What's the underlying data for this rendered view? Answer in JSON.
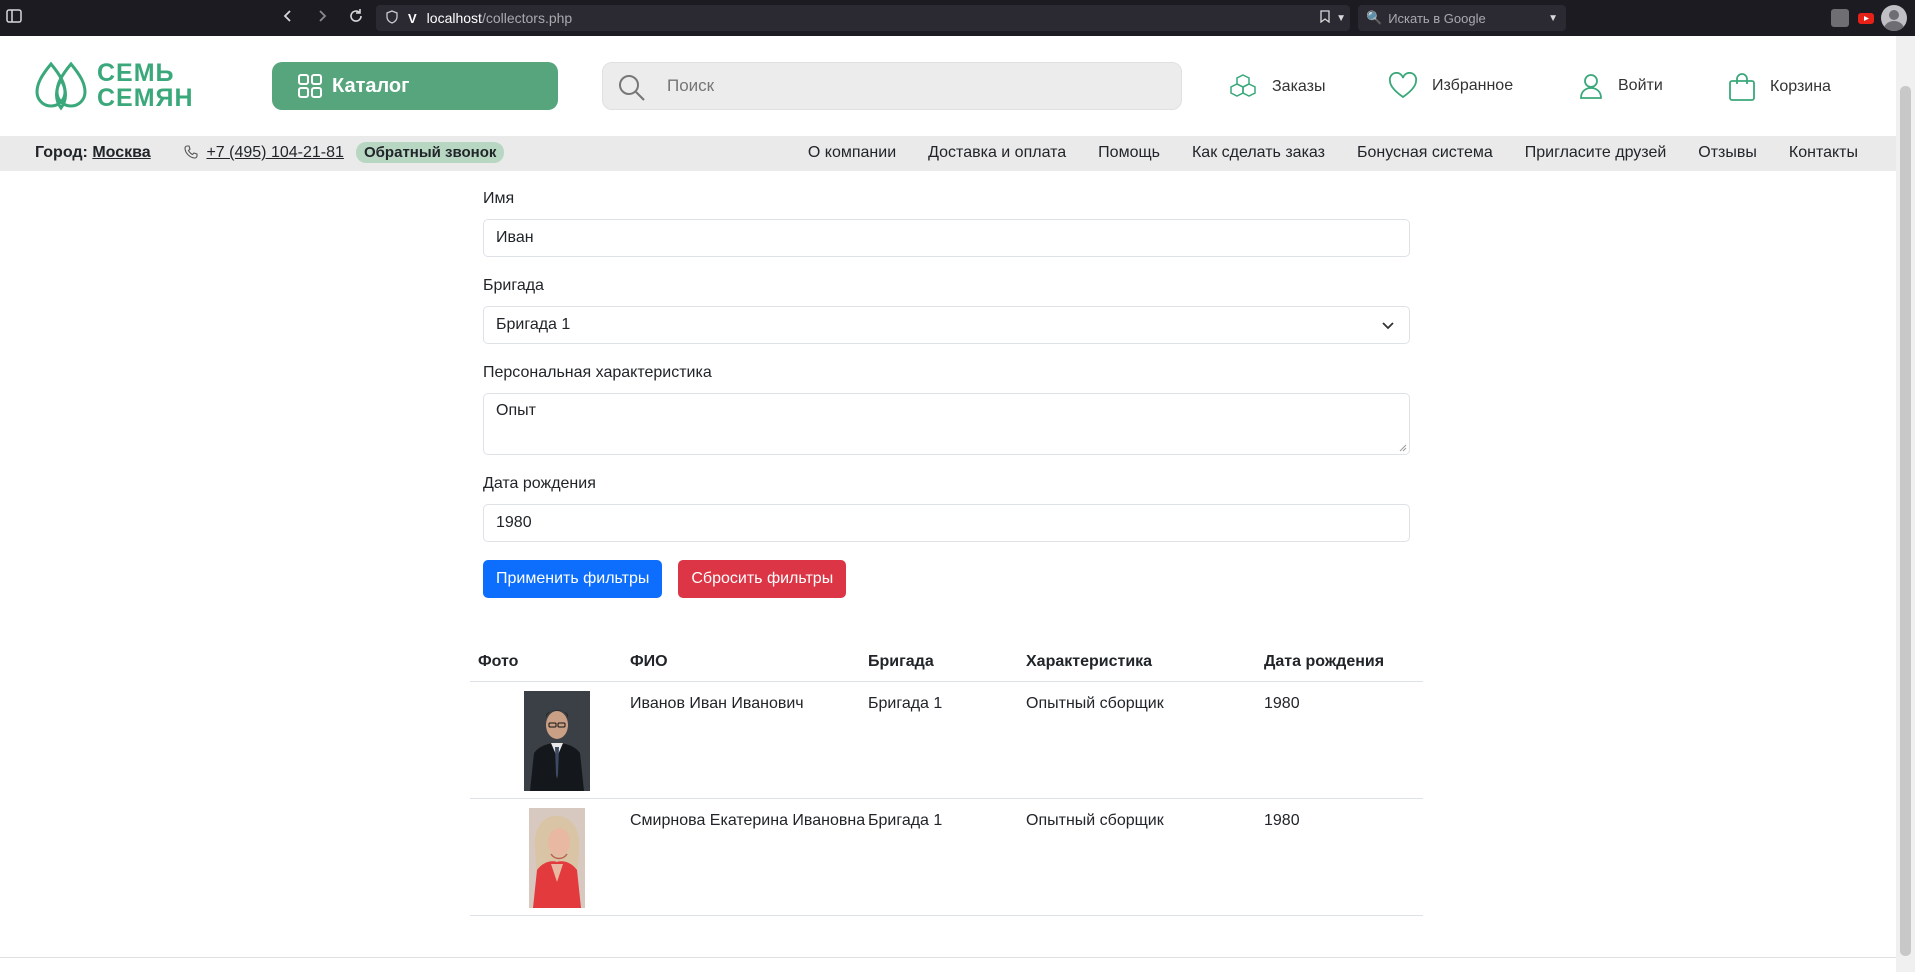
{
  "browser": {
    "url_host": "localhost",
    "url_path": "/collectors.php",
    "search_placeholder": "Искать в Google"
  },
  "header": {
    "logo_line1": "СЕМЬ",
    "logo_line2": "СЕМЯН",
    "catalog_label": "Каталог",
    "search_placeholder": "Поиск",
    "orders_label": "Заказы",
    "favorites_label": "Избранное",
    "login_label": "Войти",
    "cart_label": "Корзина"
  },
  "subnav": {
    "city_label": "Город:",
    "city_value": "Москва",
    "phone": "+7 (495) 104-21-81",
    "callback": "Обратный звонок",
    "menu": [
      "О компании",
      "Доставка и оплата",
      "Помощь",
      "Как сделать заказ",
      "Бонусная система",
      "Пригласите друзей",
      "Отзывы",
      "Контакты"
    ]
  },
  "form": {
    "name_label": "Имя",
    "name_value": "Иван",
    "brigade_label": "Бригада",
    "brigade_value": "Бригада 1",
    "characteristic_label": "Персональная характеристика",
    "characteristic_value": "Опыт",
    "birth_label": "Дата рождения",
    "birth_value": "1980",
    "apply_label": "Применить фильтры",
    "reset_label": "Сбросить фильтры"
  },
  "table": {
    "headers": [
      "Фото",
      "ФИО",
      "Бригада",
      "Характеристика",
      "Дата рождения"
    ],
    "rows": [
      {
        "name": "Иванов Иван Иванович",
        "brigade": "Бригада 1",
        "characteristic": "Опытный сборщик",
        "birth": "1980"
      },
      {
        "name": "Смирнова Екатерина Ивановна",
        "brigade": "Бригада 1",
        "characteristic": "Опытный сборщик",
        "birth": "1980"
      }
    ]
  },
  "colors": {
    "brand_green": "#57a57c",
    "primary": "#0d6efd",
    "danger": "#dc3545"
  }
}
